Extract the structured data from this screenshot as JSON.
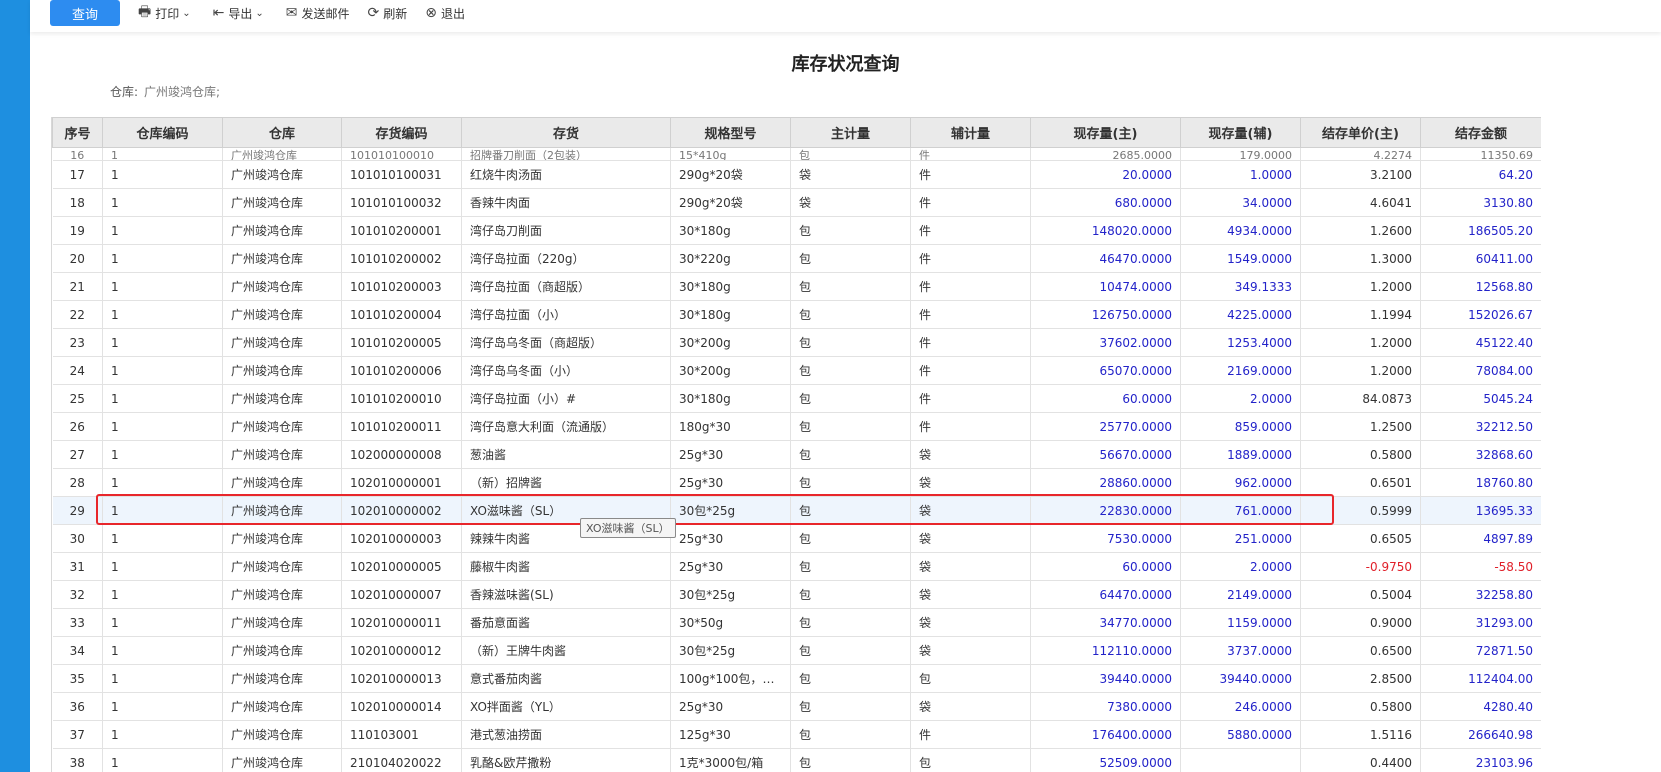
{
  "toolbar": {
    "query": "查询",
    "print": "打印",
    "export": "导出",
    "send_mail": "发送邮件",
    "refresh": "刷新",
    "exit": "退出"
  },
  "title": "库存状况查询",
  "warehouse_label": "仓库:",
  "warehouse_value": "广州竣鸿仓库;",
  "columns": [
    "序号",
    "仓库编码",
    "仓库",
    "存货编码",
    "存货",
    "规格型号",
    "主计量",
    "辅计量",
    "现存量(主)",
    "现存量(辅)",
    "结存单价(主)",
    "结存金额"
  ],
  "partial_row": [
    "16",
    "1",
    "广州竣鸿仓库",
    "101010100010",
    "招牌番刀削面（2包装）",
    "15*410g",
    "包",
    "件",
    "2685.0000",
    "179.0000",
    "4.2274",
    "11350.69"
  ],
  "rows": [
    [
      "17",
      "1",
      "广州竣鸿仓库",
      "101010100031",
      "红烧牛肉汤面",
      "290g*20袋",
      "袋",
      "件",
      "20.0000",
      "1.0000",
      "3.2100",
      "64.20"
    ],
    [
      "18",
      "1",
      "广州竣鸿仓库",
      "101010100032",
      "香辣牛肉面",
      "290g*20袋",
      "袋",
      "件",
      "680.0000",
      "34.0000",
      "4.6041",
      "3130.80"
    ],
    [
      "19",
      "1",
      "广州竣鸿仓库",
      "101010200001",
      "湾仔岛刀削面",
      "30*180g",
      "包",
      "件",
      "148020.0000",
      "4934.0000",
      "1.2600",
      "186505.20"
    ],
    [
      "20",
      "1",
      "广州竣鸿仓库",
      "101010200002",
      "湾仔岛拉面（220g）",
      "30*220g",
      "包",
      "件",
      "46470.0000",
      "1549.0000",
      "1.3000",
      "60411.00"
    ],
    [
      "21",
      "1",
      "广州竣鸿仓库",
      "101010200003",
      "湾仔岛拉面（商超版）",
      "30*180g",
      "包",
      "件",
      "10474.0000",
      "349.1333",
      "1.2000",
      "12568.80"
    ],
    [
      "22",
      "1",
      "广州竣鸿仓库",
      "101010200004",
      "湾仔岛拉面（小）",
      "30*180g",
      "包",
      "件",
      "126750.0000",
      "4225.0000",
      "1.1994",
      "152026.67"
    ],
    [
      "23",
      "1",
      "广州竣鸿仓库",
      "101010200005",
      "湾仔岛乌冬面（商超版）",
      "30*200g",
      "包",
      "件",
      "37602.0000",
      "1253.4000",
      "1.2000",
      "45122.40"
    ],
    [
      "24",
      "1",
      "广州竣鸿仓库",
      "101010200006",
      "湾仔岛乌冬面（小）",
      "30*200g",
      "包",
      "件",
      "65070.0000",
      "2169.0000",
      "1.2000",
      "78084.00"
    ],
    [
      "25",
      "1",
      "广州竣鸿仓库",
      "101010200010",
      "湾仔岛拉面（小）#",
      "30*180g",
      "包",
      "件",
      "60.0000",
      "2.0000",
      "84.0873",
      "5045.24"
    ],
    [
      "26",
      "1",
      "广州竣鸿仓库",
      "101010200011",
      "湾仔岛意大利面（流通版）",
      "180g*30",
      "包",
      "件",
      "25770.0000",
      "859.0000",
      "1.2500",
      "32212.50"
    ],
    [
      "27",
      "1",
      "广州竣鸿仓库",
      "102000000008",
      "葱油酱",
      "25g*30",
      "包",
      "袋",
      "56670.0000",
      "1889.0000",
      "0.5800",
      "32868.60"
    ],
    [
      "28",
      "1",
      "广州竣鸿仓库",
      "102010000001",
      "（新）招牌酱",
      "25g*30",
      "包",
      "袋",
      "28860.0000",
      "962.0000",
      "0.6501",
      "18760.80"
    ],
    [
      "29",
      "1",
      "广州竣鸿仓库",
      "102010000002",
      "XO滋味酱（SL）",
      "30包*25g",
      "包",
      "袋",
      "22830.0000",
      "761.0000",
      "0.5999",
      "13695.33"
    ],
    [
      "30",
      "1",
      "广州竣鸿仓库",
      "102010000003",
      "辣辣牛肉酱",
      "25g*30",
      "包",
      "袋",
      "7530.0000",
      "251.0000",
      "0.6505",
      "4897.89"
    ],
    [
      "31",
      "1",
      "广州竣鸿仓库",
      "102010000005",
      "藤椒牛肉酱",
      "25g*30",
      "包",
      "袋",
      "60.0000",
      "2.0000",
      "-0.9750",
      "-58.50"
    ],
    [
      "32",
      "1",
      "广州竣鸿仓库",
      "102010000007",
      "香辣滋味酱(SL)",
      "30包*25g",
      "包",
      "袋",
      "64470.0000",
      "2149.0000",
      "0.5004",
      "32258.80"
    ],
    [
      "33",
      "1",
      "广州竣鸿仓库",
      "102010000011",
      "番茄意面酱",
      "30*50g",
      "包",
      "袋",
      "34770.0000",
      "1159.0000",
      "0.9000",
      "31293.00"
    ],
    [
      "34",
      "1",
      "广州竣鸿仓库",
      "102010000012",
      "（新）王牌牛肉酱",
      "30包*25g",
      "包",
      "袋",
      "112110.0000",
      "3737.0000",
      "0.6500",
      "72871.50"
    ],
    [
      "35",
      "1",
      "广州竣鸿仓库",
      "102010000013",
      "意式番茄肉酱",
      "100g*100包，1…",
      "包",
      "包",
      "39440.0000",
      "39440.0000",
      "2.8500",
      "112404.00"
    ],
    [
      "36",
      "1",
      "广州竣鸿仓库",
      "102010000014",
      "XO拌面酱（YL）",
      "25g*30",
      "包",
      "袋",
      "7380.0000",
      "246.0000",
      "0.5800",
      "4280.40"
    ],
    [
      "37",
      "1",
      "广州竣鸿仓库",
      "110103001",
      "港式葱油捞面",
      "125g*30",
      "包",
      "件",
      "176400.0000",
      "5880.0000",
      "1.5116",
      "266640.98"
    ],
    [
      "38",
      "1",
      "广州竣鸿仓库",
      "210104020022",
      "乳酪&欧芹撒粉",
      "1克*3000包/箱",
      "包",
      "包",
      "52509.0000",
      "",
      "0.4400",
      "23103.96"
    ]
  ],
  "selected_row_index": 12,
  "tooltip": "XO滋味酱（SL）",
  "colors": {
    "accent": "#2d8cf0",
    "left_strip": "#1e8fe0",
    "number": "#2323c9",
    "negative": "#e0202a",
    "highlight_border": "#e8262b"
  }
}
